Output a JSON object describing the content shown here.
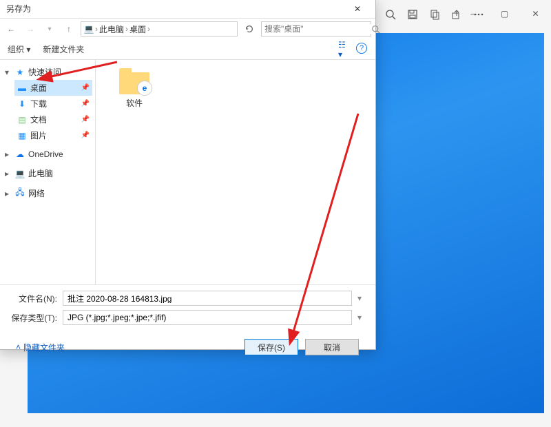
{
  "viewer": {
    "tools": [
      "🔍",
      "💾",
      "📄",
      "↗",
      "⋯"
    ]
  },
  "dialog": {
    "title": "另存为",
    "breadcrumb": {
      "root_icon": "🖥",
      "root": "此电脑",
      "loc": "桌面"
    },
    "search": {
      "placeholder": "搜索\"桌面\""
    },
    "toolbar": {
      "organize": "组织 ▾",
      "new_folder": "新建文件夹"
    },
    "tree": {
      "quick_access": "快速访问",
      "quick_items": [
        {
          "label": "桌面",
          "icon": "🖥",
          "selected": true
        },
        {
          "label": "下载",
          "icon": "⬇",
          "selected": false
        },
        {
          "label": "文档",
          "icon": "📄",
          "selected": false
        },
        {
          "label": "图片",
          "icon": "🖼",
          "selected": false
        }
      ],
      "onedrive": "OneDrive",
      "this_pc": "此电脑",
      "network": "网络"
    },
    "files": [
      {
        "label": "软件"
      }
    ],
    "filename_label": "文件名(N):",
    "filename_value": "批注 2020-08-28 164813.jpg",
    "filetype_label": "保存类型(T):",
    "filetype_value": "JPG (*.jpg;*.jpeg;*.jpe;*.jfif)",
    "hide_folders": "隐藏文件夹",
    "save_btn": "保存(S)",
    "cancel_btn": "取消"
  }
}
